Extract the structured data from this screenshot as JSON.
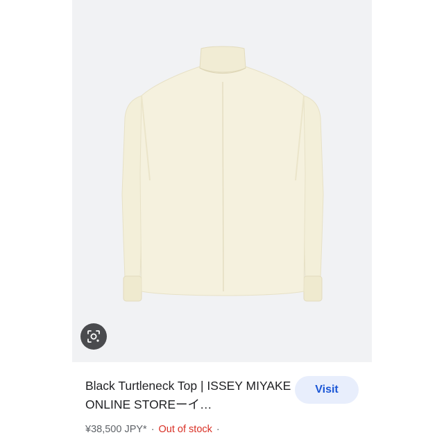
{
  "result": {
    "title": "Black Turtleneck Top | ISSEY MIYAKE ONLINE STOREーイ…",
    "visit_label": "Visit",
    "price": "¥38,500 JPY*",
    "separator": "·",
    "stock_status": "Out of stock",
    "trailing_separator": "·"
  },
  "icons": {
    "lens": "lens-search-icon",
    "product": "cream-mock-neck-long-sleeve-top"
  },
  "colors": {
    "image_background": "#f1f2f4",
    "garment": "#f4f0dc",
    "visit_bg": "#e8eefc",
    "visit_text": "#1a56d6",
    "out_of_stock": "#d93025",
    "meta_text": "#5f6368"
  }
}
